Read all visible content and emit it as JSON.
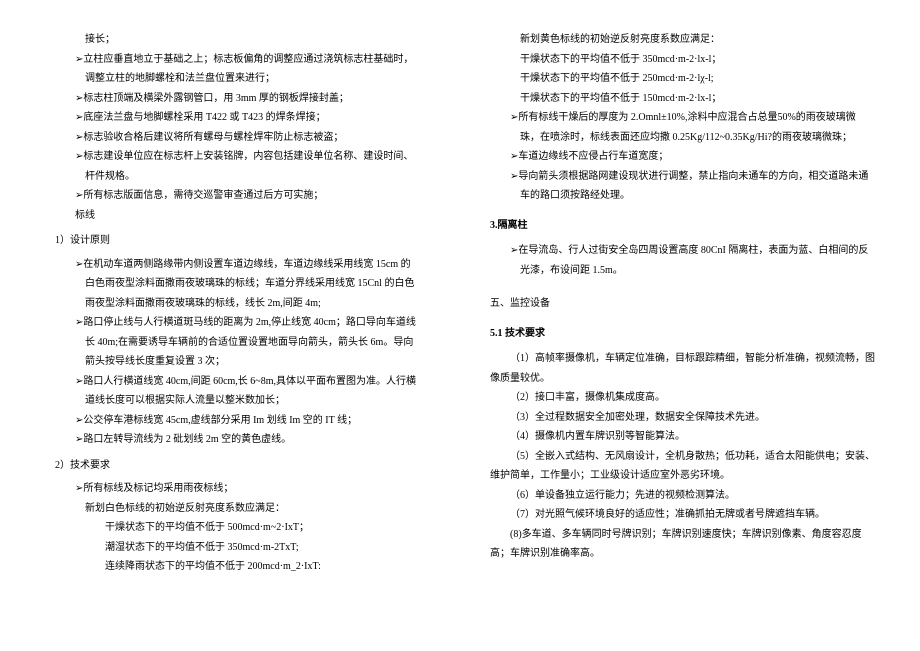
{
  "left": {
    "l0": "接长；",
    "l1": "➢立柱应垂直地立于基础之上；标志板偏角的调整应通过浇筑标志柱基础时，调整立柱的地脚螺栓和法兰盘位置来进行；",
    "l2": "➢标志柱顶端及横梁外露钢管口，用 3mm 厚的钢板焊接封盖；",
    "l3": "➢底座法兰盘与地脚螺栓采用 T422 或 T423 的焊条焊接；",
    "l4": "➢标志验收合格后建议将所有螺母与螺栓焊牢防止标志被盗；",
    "l5": "➢标志建设单位应在标志杆上安装铭牌，内容包括建设单位名称、建设时间、杆件规格。",
    "l6": "➢所有标志版面信息，需待交巡警审查通过后方可实施；",
    "l7": "标线",
    "l8": "1）设计原则",
    "l9": "➢在机动车道两侧路缘带内侧设置车道边缘线，车道边缘线采用线宽 15cm 的白色雨夜型涂料面撒雨夜玻璃珠的标线；车道分界线采用线宽 15Cnl 的白色雨夜型涂料面撒雨夜玻璃珠的标线，线长 2m,间距 4m;",
    "l10": "➢路口停止线与人行横道斑马线的距离为 2m,停止线宽 40cm；路口导向车道线长 40m;在需要诱导车辆前的合适位置设置地面导向箭头，箭头长 6m。导向箭头按导线长度重复设置 3 次；",
    "l11": "➢路口人行横道线宽 40cm,间距 60cm,长 6~8m,具体以平面布置图为准。人行横道线长度可以根据实际人流量以整米数加长；",
    "l12": "➢公交停车港标线宽 45cm,虚线部分采用 Im 划线 Im 空的 IT 线；",
    "l13": "➢路口左转导流线为 2 砒划线 2m 空的黄色虚线。",
    "l14": "2）技术要求",
    "l15": "➢所有标线及标记均采用雨夜标线；",
    "l16": "新划白色标线的初始逆反射亮度系数应满足：",
    "l17": "干燥状态下的平均值不低于 500mcd·m~2·IxT；",
    "l18": "潮湿状态下的平均值不低于 350mcd·m-2TxT;",
    "l19": "连续降雨状态下的平均值不低于 200mcd·m_2·IxT:"
  },
  "right": {
    "r0": "新划黄色标线的初始逆反射亮度系数应满足：",
    "r1": "干燥状态下的平均值不低于 350mcd·m-2·lx-l；",
    "r2": "干燥状态下的平均值不低于 250mcd·m-2·lχ-l;",
    "r3": "干燥状态下的平均值不低于 150mcd·m-2·lx-l；",
    "r4": "➢所有标线干燥后的厚度为 2.Omnl±10%,涂料中应混合占总量50%的雨夜玻璃微珠，在喷涂时，标线表面还应均撒 0.25Kg/112~0.35Kg/Hi?的雨夜玻璃微珠；",
    "r5": "➢车道边缘线不应侵占行车道宽度；",
    "r6": "➢导向箭头须根据路网建设现状进行调整，禁止指向未通车的方向，相交道路未通车的路口须按路经处理。",
    "h3": "3.隔离柱",
    "r7": "➢在导流岛、行人过街安全岛四周设置高度 80CnI 隔离柱，表面为蓝、白相间的反光漆，布设间距 1.5m。",
    "h5": "五、监控设备",
    "h51": "5.1 技术要求",
    "r8": "（1）高帧率摄像机，车辆定位准确，目标跟踪精细，智能分析准确，视频流畅，图像质量较优。",
    "r9": "（2）接口丰富，摄像机集成度高。",
    "r10": "（3）全过程数据安全加密处理，数据安全保障技术先进。",
    "r11": "（4）摄像机内置车牌识别等智能算法。",
    "r12": "（5）全嵌入式结构、无风扇设计，全机身散热；低功耗，适合太阳能供电；安装、维护简单，工作量小；工业级设计适应室外恶劣环境。",
    "r13": "（6）单设备独立运行能力；先进的视频检测算法。",
    "r14": "（7）对光照气候环境良好的适应性；准确抓拍无牌或者号牌遮挡车辆。",
    "r15": "(8)多车道、多车辆同时号牌识别；车牌识别速度快；车牌识别像素、角度容忍度高；车牌识别准确率高。"
  }
}
